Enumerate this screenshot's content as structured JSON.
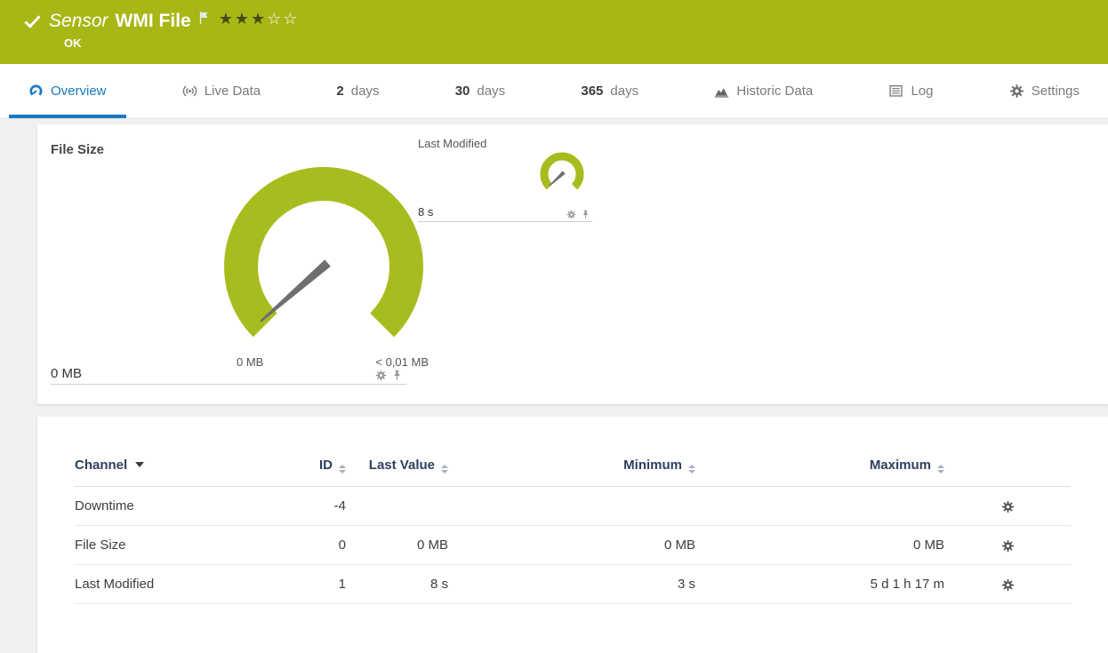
{
  "colors": {
    "header_green": "#a8b616",
    "gauge_green": "#a9bc1f",
    "accent_blue": "#1779c4"
  },
  "header": {
    "kind": "Sensor",
    "title": "WMI File",
    "status": "OK",
    "stars_filled": "★★★",
    "stars_empty": "☆☆"
  },
  "tabs": {
    "overview": "Overview",
    "live_data": "Live Data",
    "d2_num": "2",
    "d2_label": "days",
    "d30_num": "30",
    "d30_label": "days",
    "d365_num": "365",
    "d365_label": "days",
    "historic": "Historic Data",
    "log": "Log",
    "settings": "Settings"
  },
  "gauges": {
    "file_size": {
      "title": "File Size",
      "value": "0 MB",
      "min": "0 MB",
      "max": "< 0,01 MB"
    },
    "last_modified": {
      "title": "Last Modified",
      "value": "8 s"
    }
  },
  "table": {
    "headers": {
      "channel": "Channel",
      "id": "ID",
      "last_value": "Last Value",
      "minimum": "Minimum",
      "maximum": "Maximum"
    },
    "rows": [
      {
        "channel": "Downtime",
        "id": "-4",
        "last_value": "",
        "minimum": "",
        "maximum": ""
      },
      {
        "channel": "File Size",
        "id": "0",
        "last_value": "0 MB",
        "minimum": "0 MB",
        "maximum": "0 MB"
      },
      {
        "channel": "Last Modified",
        "id": "1",
        "last_value": "8 s",
        "minimum": "3 s",
        "maximum": "5 d 1 h 17 m"
      }
    ]
  }
}
